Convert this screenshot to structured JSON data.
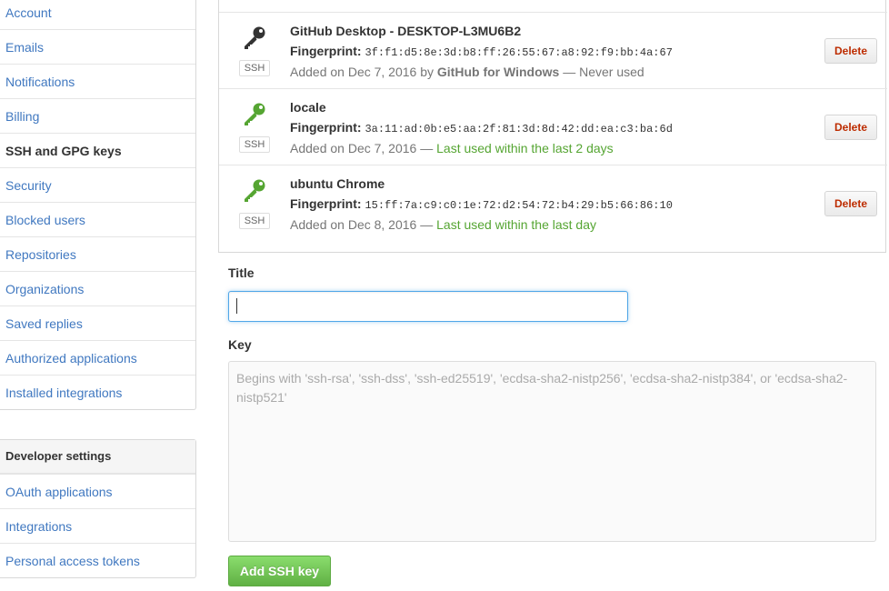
{
  "sidebar": {
    "items": [
      {
        "label": "Account"
      },
      {
        "label": "Emails"
      },
      {
        "label": "Notifications"
      },
      {
        "label": "Billing"
      },
      {
        "label": "SSH and GPG keys"
      },
      {
        "label": "Security"
      },
      {
        "label": "Blocked users"
      },
      {
        "label": "Repositories"
      },
      {
        "label": "Organizations"
      },
      {
        "label": "Saved replies"
      },
      {
        "label": "Authorized applications"
      },
      {
        "label": "Installed integrations"
      }
    ],
    "selected": "SSH and GPG keys"
  },
  "developer_settings": {
    "heading": "Developer settings",
    "items": [
      {
        "label": "OAuth applications"
      },
      {
        "label": "Integrations"
      },
      {
        "label": "Personal access tokens"
      }
    ]
  },
  "keys": [
    {
      "title": "GitHub Desktop - DESKTOP-L3MU6B2",
      "fingerprint_label": "Fingerprint:",
      "fingerprint": "3f:f1:d5:8e:3d:b8:ff:26:55:67:a8:92:f9:bb:4a:67",
      "added": "Added on Dec 7, 2016 by",
      "added_by": "GitHub for Windows",
      "usage": "— Never used",
      "type_label": "SSH",
      "icon": "key-icon",
      "icon_color": "#333333",
      "delete_label": "Delete"
    },
    {
      "title": "locale",
      "fingerprint_label": "Fingerprint:",
      "fingerprint": "3a:11:ad:0b:e5:aa:2f:81:3d:8d:42:dd:ea:c3:ba:6d",
      "added": "Added on Dec 7, 2016 —",
      "usage": "Last used within the last 2 days",
      "type_label": "SSH",
      "icon": "key-icon",
      "icon_color": "#55a532",
      "delete_label": "Delete"
    },
    {
      "title": "ubuntu Chrome",
      "fingerprint_label": "Fingerprint:",
      "fingerprint": "15:ff:7a:c9:c0:1e:72:d2:54:72:b4:29:b5:66:86:10",
      "added": "Added on Dec 8, 2016 —",
      "usage": "Last used within the last day",
      "type_label": "SSH",
      "icon": "key-icon",
      "icon_color": "#55a532",
      "delete_label": "Delete"
    }
  ],
  "form": {
    "title_label": "Title",
    "title_value": "",
    "key_label": "Key",
    "key_placeholder": "Begins with 'ssh-rsa', 'ssh-dss', 'ssh-ed25519', 'ecdsa-sha2-nistp256', 'ecdsa-sha2-nistp384', or 'ecdsa-sha2-nistp521'",
    "submit_label": "Add SSH key"
  },
  "colors": {
    "link": "#4078c0",
    "danger": "#bd2c00",
    "success": "#55a532",
    "focus": "#51a7e8"
  }
}
